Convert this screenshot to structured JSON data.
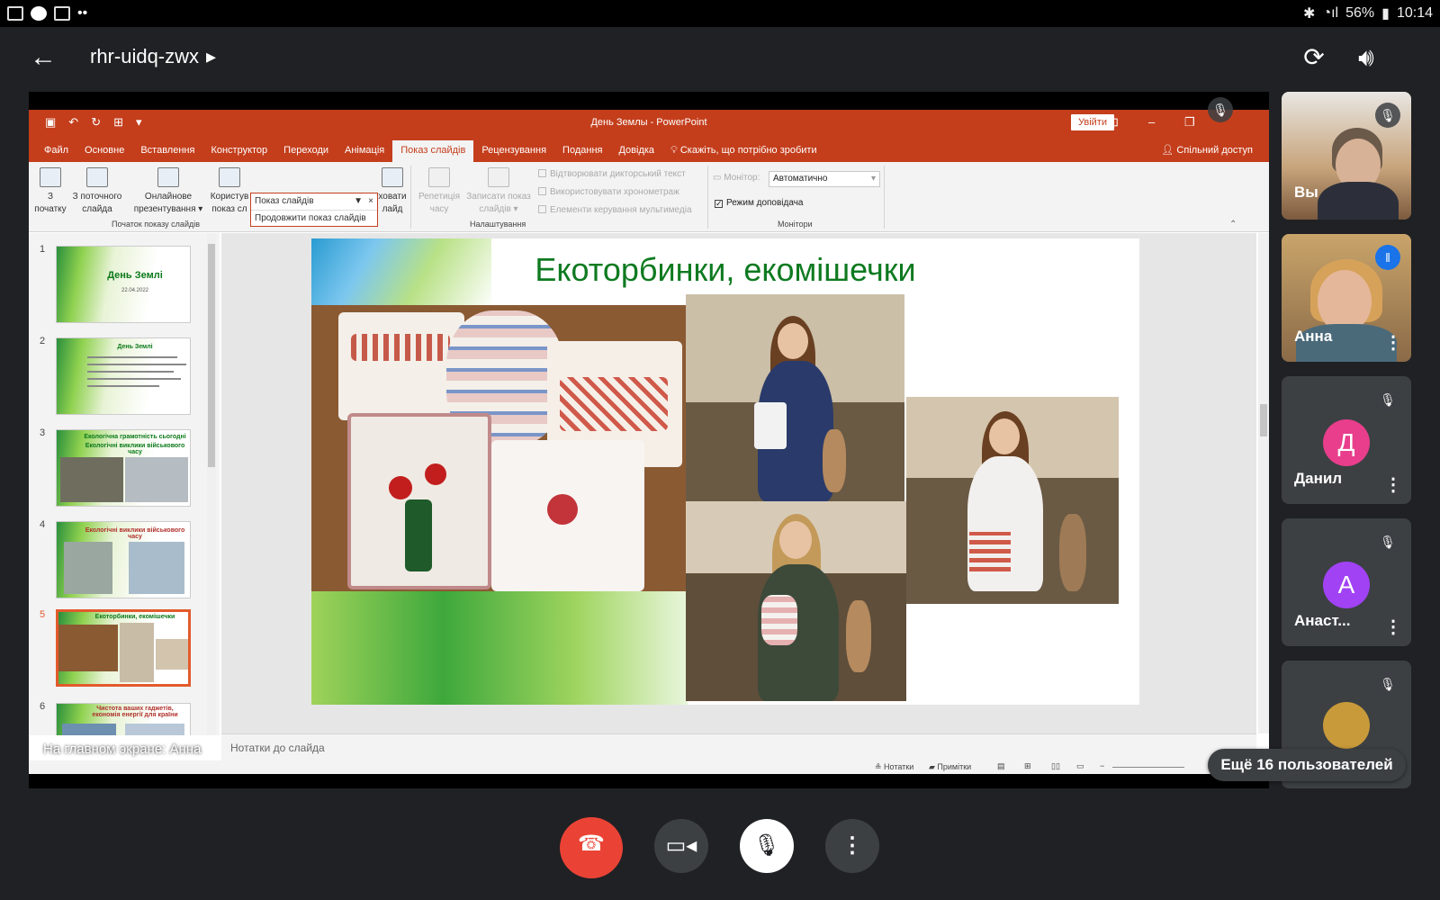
{
  "status_bar": {
    "battery": "56%",
    "time": "10:14"
  },
  "meet": {
    "code": "rhr-uidq-zwx",
    "presenter_label": "На главном экране: Анна",
    "more_users": "Ещё 16 пользователей"
  },
  "ppt": {
    "title": "День Землы  -  PowerPoint",
    "signin": "Увійти",
    "tabs": [
      "Файл",
      "Основне",
      "Вставлення",
      "Конструктор",
      "Переходи",
      "Анімація",
      "Показ слайдів",
      "Рецензування",
      "Подання",
      "Довідка"
    ],
    "tell_me": "Скажіть, що потрібно зробити",
    "share": "Спільний доступ",
    "ribbon": {
      "btn_from_start": [
        "З",
        "початку"
      ],
      "btn_from_current": [
        "З поточного",
        "слайда"
      ],
      "btn_online": [
        "Онлайнове",
        "презентування ▾"
      ],
      "btn_custom": [
        "Користув",
        "показ сл"
      ],
      "btn_hide": [
        "ховати",
        "лайд"
      ],
      "btn_rehearse": [
        "Репетиція",
        "часу"
      ],
      "btn_record": [
        "Записати показ",
        "слайдів ▾"
      ],
      "group_start": "Початок показу слайдів",
      "group_setup": "Налаштування",
      "group_monitors": "Монітори",
      "chk_narration": "Відтворювати дикторський текст",
      "chk_timings": "Використовувати хронометраж",
      "chk_media": "Елементи керування мультимедіа",
      "monitor_label": "Монітор:",
      "monitor_value": "Автоматично",
      "presenter_view": "Режим доповідача"
    },
    "dropdown": {
      "title": "Показ слайдів",
      "option": "Продовжити показ слайдів"
    },
    "thumbnails": [
      {
        "num": "1",
        "title": "День Землі",
        "sub": "22.04.2022"
      },
      {
        "num": "2",
        "title": "День Землі",
        "sub": ""
      },
      {
        "num": "3",
        "title": "Екологічна грамотність сьогодні",
        "sub": "Екологічні виклики військового часу"
      },
      {
        "num": "4",
        "title": "Екологічні виклики військового часу",
        "sub": ""
      },
      {
        "num": "5",
        "title": "Екоторбинки, екомішечки",
        "sub": ""
      },
      {
        "num": "6",
        "title": "Чистота ваших гаджетів, економія енергії для країни",
        "sub": ""
      }
    ],
    "slide_title": "Екоторбинки, екомішечки",
    "notes_placeholder": "Нотатки до слайда",
    "status_notes": "Нотатки",
    "status_comments": "Примітки"
  },
  "participants": [
    {
      "name": "Вы"
    },
    {
      "name": "Анна"
    },
    {
      "name": "Данил",
      "initial": "Д"
    },
    {
      "name": "Анаст...",
      "initial": "А"
    }
  ],
  "colors": {
    "ppt_accent": "#c43e1c",
    "end_call": "#ea4335",
    "avatar_d": "#e83e8c",
    "avatar_a": "#a142f4",
    "speaking": "#1a73e8"
  }
}
